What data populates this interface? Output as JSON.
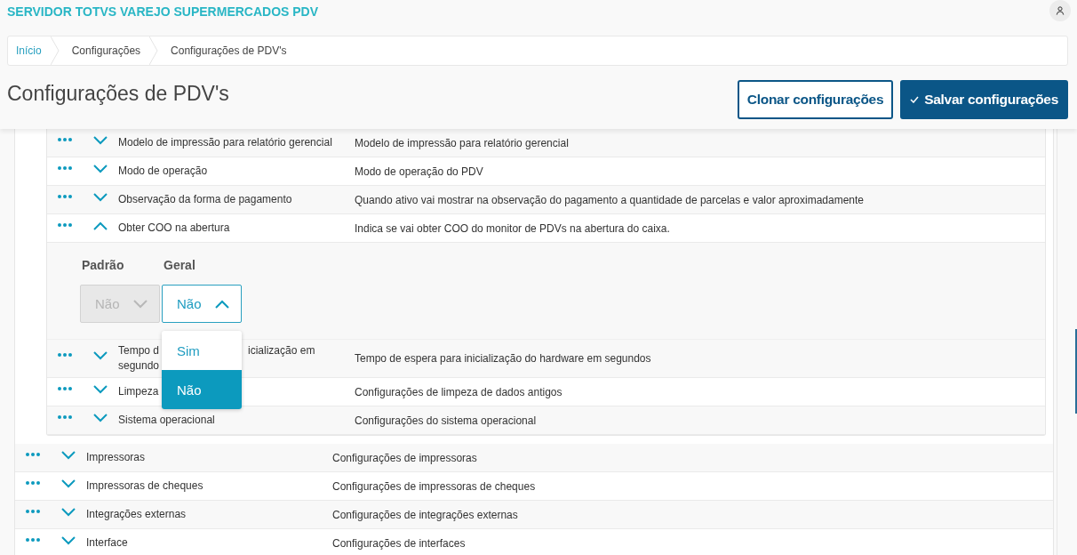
{
  "app_title": "SERVIDOR TOTVS VAREJO SUPERMERCADOS PDV",
  "breadcrumb": [
    {
      "label": "Início",
      "link": true
    },
    {
      "label": "Configurações",
      "link": false
    },
    {
      "label": "Configurações de PDV's",
      "link": false
    }
  ],
  "page_title": "Configurações de PDV's",
  "actions": [
    {
      "label": "Clonar configurações",
      "kind": "secondary"
    },
    {
      "label": "Salvar configurações",
      "kind": "primary"
    }
  ],
  "nested_settings": [
    {
      "name_lines": [
        [
          "Modelo de impressão para relatório gerencial"
        ]
      ],
      "description": "Modelo de impressão para relatório gerencial",
      "expanded": false
    },
    {
      "name_lines": [
        [
          "Modo de operação"
        ]
      ],
      "description": "Modo de operação do PDV",
      "expanded": false
    },
    {
      "name_lines": [
        [
          "Observação da forma de pagamento"
        ]
      ],
      "description": "Quando ativo vai mostrar na observação do pagamento a quantidade de parcelas e valor aproximadamente",
      "expanded": false
    },
    {
      "name_lines": [
        [
          "Obter COO na abertura"
        ]
      ],
      "description": "Indica se vai obter COO do monitor de PDVs na abertura do caixa.",
      "expanded": true,
      "fields": [
        {
          "label": "Padrão",
          "value": "Não",
          "disabled": true,
          "open": false
        },
        {
          "label": "Geral",
          "value": "Não",
          "disabled": false,
          "open": true,
          "options": [
            {
              "label": "Sim",
              "selected": false
            },
            {
              "label": "Não",
              "selected": true
            }
          ]
        }
      ]
    },
    {
      "name_lines": [
        [
          "Tempo d",
          "icialização em"
        ],
        [
          "segundo"
        ]
      ],
      "description": "Tempo de espera para inicialização do hardware em segundos",
      "expanded": false
    },
    {
      "name_lines": [
        [
          "Limpeza"
        ]
      ],
      "description": "Configurações de limpeza de dados antigos",
      "expanded": false
    },
    {
      "name_lines": [
        [
          "Sistema operacional"
        ]
      ],
      "description": "Configurações do sistema operacional",
      "expanded": false
    }
  ],
  "settings": [
    {
      "name_lines": [
        [
          "Impressoras"
        ]
      ],
      "description": "Configurações de impressoras",
      "expanded": false
    },
    {
      "name_lines": [
        [
          "Impressoras de cheques"
        ]
      ],
      "description": "Configurações de impressoras de cheques",
      "expanded": false
    },
    {
      "name_lines": [
        [
          "Integrações externas"
        ]
      ],
      "description": "Configurações de integrações externas",
      "expanded": false
    },
    {
      "name_lines": [
        [
          "Interface"
        ]
      ],
      "description": "Configurações de interfaces",
      "expanded": false
    }
  ]
}
